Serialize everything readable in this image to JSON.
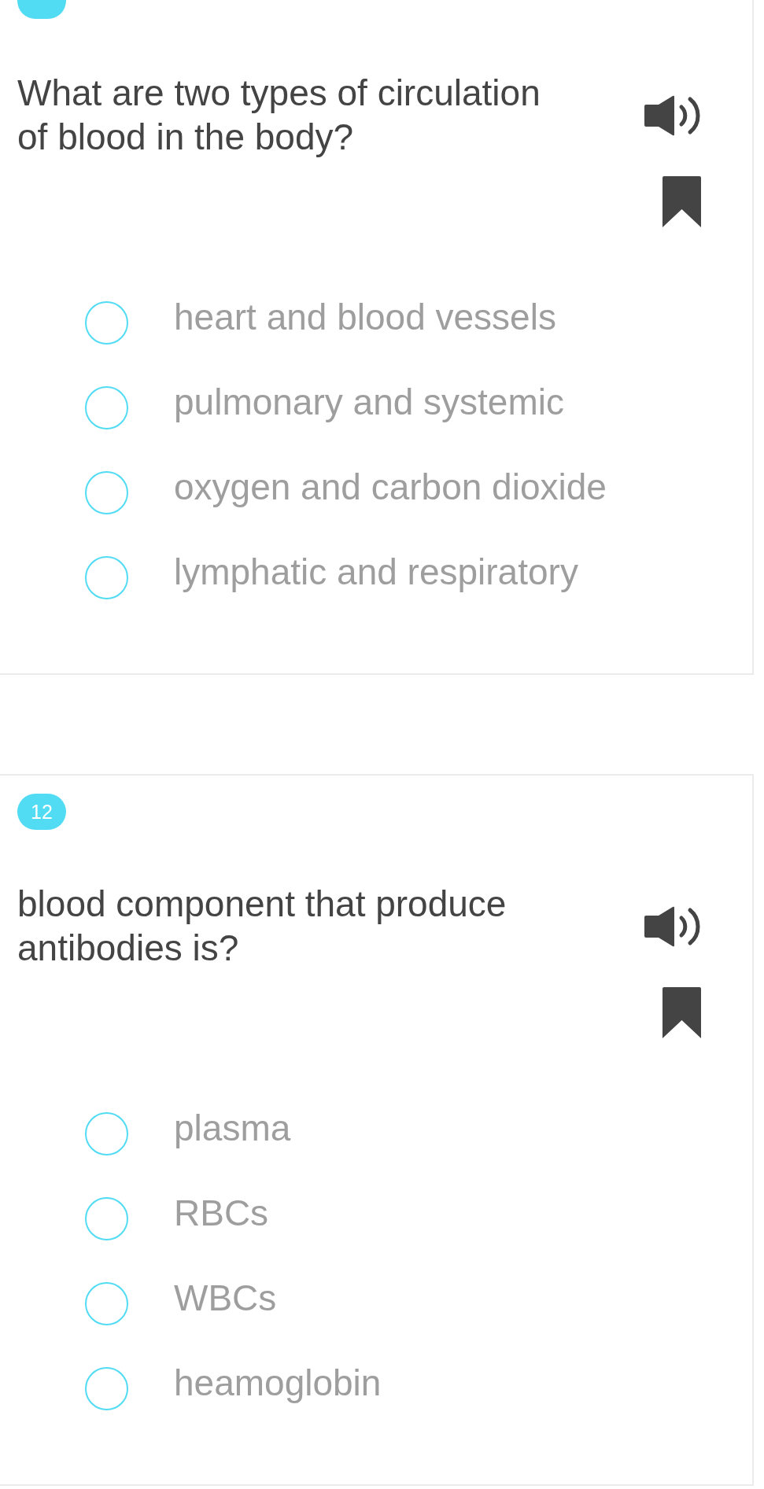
{
  "questions": [
    {
      "question": "What are two types of circulation of blood in the body?",
      "options": [
        {
          "text": "heart and blood vessels",
          "selected": false
        },
        {
          "text": "pulmonary and systemic",
          "selected": false
        },
        {
          "text": "oxygen and carbon dioxide",
          "selected": false
        },
        {
          "text": "lymphatic and respiratory",
          "selected": false
        }
      ]
    },
    {
      "number": "12",
      "question": "blood component that produce antibodies is?",
      "options": [
        {
          "text": "plasma",
          "selected": false
        },
        {
          "text": "RBCs",
          "selected": false
        },
        {
          "text": "WBCs",
          "selected": false
        },
        {
          "text": "heamoglobin",
          "selected": false
        }
      ]
    }
  ]
}
